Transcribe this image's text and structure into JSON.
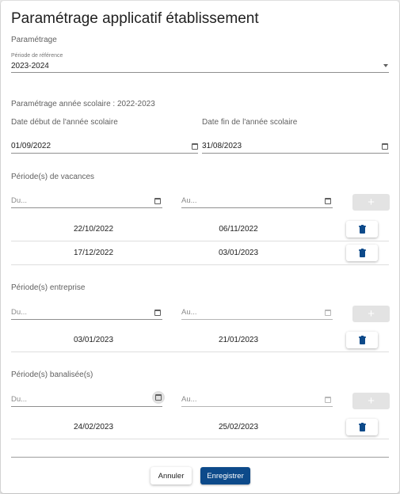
{
  "dialog": {
    "title": "Paramétrage applicatif établissement",
    "section_parametrage": "Paramétrage"
  },
  "reference": {
    "label": "Période de référence",
    "value": "2023-2024"
  },
  "school_year": {
    "heading": "Paramétrage année scolaire : 2022-2023",
    "start_label": "Date début de l'année scolaire",
    "start_value": "01/09/2022",
    "end_label": "Date fin de l'année scolaire",
    "end_value": "31/08/2023"
  },
  "vacances": {
    "label": "Période(s) de vacances",
    "from_placeholder": "Du...",
    "to_placeholder": "Au...",
    "add_label": "+",
    "rows": [
      {
        "from": "22/10/2022",
        "to": "06/11/2022"
      },
      {
        "from": "17/12/2022",
        "to": "03/01/2023"
      }
    ]
  },
  "entreprise": {
    "label": "Période(s) entreprise",
    "from_placeholder": "Du...",
    "to_placeholder": "Au...",
    "add_label": "+",
    "rows": [
      {
        "from": "03/01/2023",
        "to": "21/01/2023"
      }
    ]
  },
  "banalisees": {
    "label": "Période(s) banalisée(s)",
    "from_placeholder": "Du...",
    "to_placeholder": "Au...",
    "add_label": "+",
    "rows": [
      {
        "from": "24/02/2023",
        "to": "25/02/2023"
      }
    ]
  },
  "actions": {
    "cancel_label": "Annuler",
    "save_label": "Enregistrer"
  },
  "icons": {
    "calendar": "calendar-icon",
    "delete": "trash-icon",
    "dropdown": "chevron-down-icon",
    "add": "plus-icon"
  },
  "colors": {
    "primary": "#0d4a8a",
    "disabled_button": "#e3e3e3",
    "text": "#212121",
    "secondary_text": "#616161"
  }
}
